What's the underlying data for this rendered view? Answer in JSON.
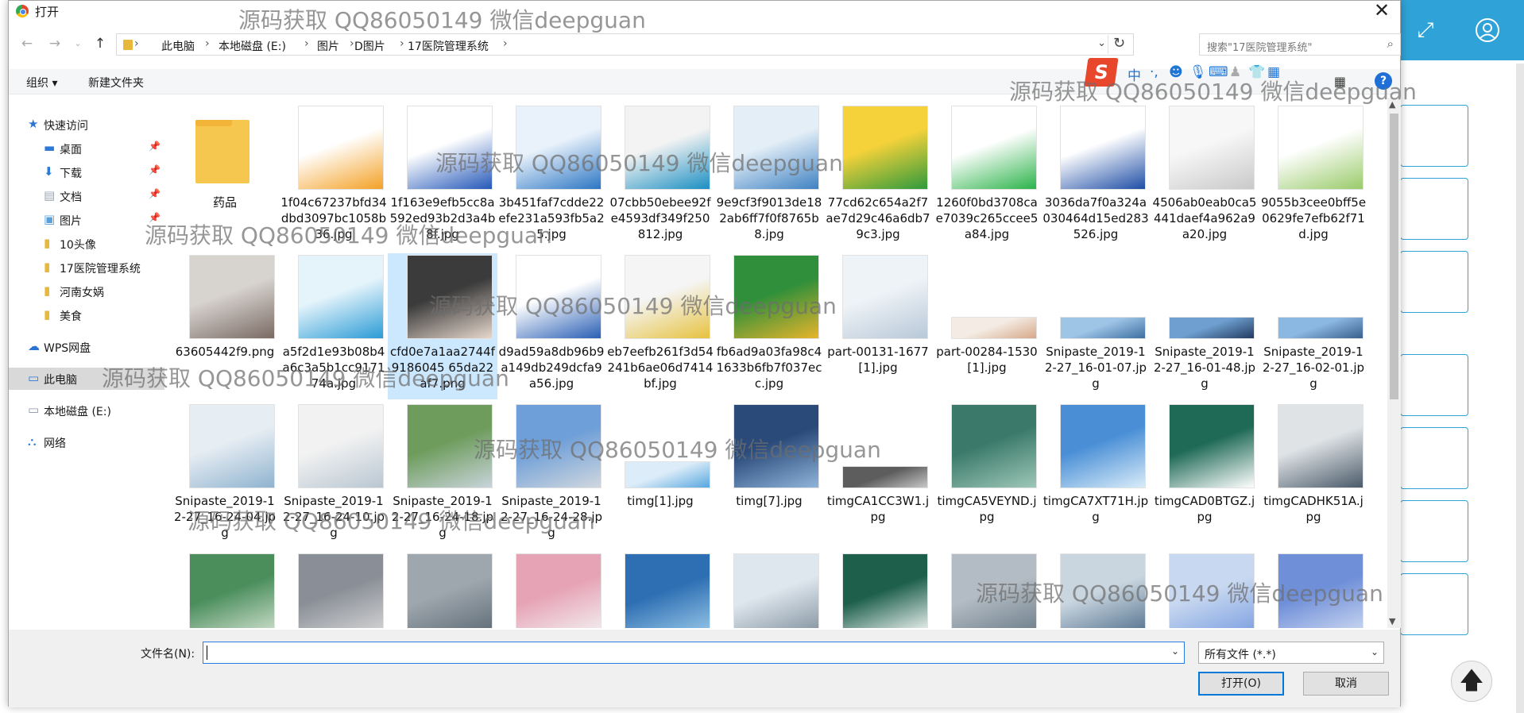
{
  "dialog": {
    "title": "打开"
  },
  "address": {
    "segments": [
      "此电脑",
      "本地磁盘 (E:)",
      "图片",
      "D图片",
      "17医院管理系统"
    ],
    "search_placeholder": "搜索\"17医院管理系统\""
  },
  "toolbar": {
    "organize": "组织 ▾",
    "new_folder": "新建文件夹",
    "help": "?"
  },
  "ime": {
    "logo": "S",
    "lang": "中"
  },
  "sidebar": {
    "items": [
      {
        "label": "快速访问",
        "icon": "star-icon",
        "color": "#2b73d2"
      },
      {
        "label": "桌面",
        "icon": "desktop-icon",
        "color": "#2b7ad8",
        "pinned": true
      },
      {
        "label": "下载",
        "icon": "download-icon",
        "color": "#2b7ad8",
        "pinned": true
      },
      {
        "label": "文档",
        "icon": "document-icon",
        "color": "#9aa6b5",
        "pinned": true
      },
      {
        "label": "图片",
        "icon": "pictures-icon",
        "color": "#5aa0dd",
        "pinned": true
      },
      {
        "label": "10头像",
        "icon": "folder-icon",
        "color": "#e8b83c"
      },
      {
        "label": "17医院管理系统",
        "icon": "folder-icon",
        "color": "#e8b83c"
      },
      {
        "label": "河南女娲",
        "icon": "folder-icon",
        "color": "#e8b83c"
      },
      {
        "label": "美食",
        "icon": "folder-icon",
        "color": "#e8b83c"
      },
      {
        "label": "WPS网盘",
        "icon": "cloud-icon",
        "color": "#2b73d2"
      },
      {
        "label": "此电脑",
        "icon": "computer-icon",
        "color": "#2b7ad8",
        "selected": true
      },
      {
        "label": "本地磁盘 (E:)",
        "icon": "drive-icon",
        "color": "#8a96a3"
      },
      {
        "label": "网络",
        "icon": "network-icon",
        "color": "#2b7ad8"
      }
    ]
  },
  "files": [
    {
      "name": "药品",
      "type": "folder"
    },
    {
      "name": "1f04c67237bfd34dbd3097bc1058b36.jpg",
      "colors": [
        "#ffffff",
        "#f4a126"
      ]
    },
    {
      "name": "1f163e9efb5cc8a592ed93b2d3a4b8f.jpg",
      "colors": [
        "#ffffff",
        "#2558b9"
      ]
    },
    {
      "name": "3b451faf7cdde22efe231a593fb5a25.jpg",
      "colors": [
        "#e9f2fb",
        "#2c76c4"
      ]
    },
    {
      "name": "07cbb50ebee92fe4593df349f250812.jpg",
      "colors": [
        "#f3f3f3",
        "#1b8fc2"
      ]
    },
    {
      "name": "9e9cf3f9013de182ab6ff7f0f8765b8.jpg",
      "colors": [
        "#e3eef7",
        "#3f82c3"
      ]
    },
    {
      "name": "77cd62c654a2f7ae7d29c46a6db79c3.jpg",
      "colors": [
        "#f6d23a",
        "#2f9a3c"
      ]
    },
    {
      "name": "1260f0bd3708cae7039c265ccee5a84.jpg",
      "colors": [
        "#ffffff",
        "#2cb34a"
      ]
    },
    {
      "name": "3036da7f0a324a030464d15ed283526.jpg",
      "colors": [
        "#ffffff",
        "#1f4ea6"
      ]
    },
    {
      "name": "4506ab0eab0ca5441daef4a962a9a20.jpg",
      "colors": [
        "#f7f7f7",
        "#c9c9c9"
      ]
    },
    {
      "name": "9055b3cee0bff5e0629fe7efb62f71d.jpg",
      "colors": [
        "#ffffff",
        "#9acb6a"
      ]
    },
    {
      "name": "63605442f9.png",
      "colors": [
        "#d7d3cf",
        "#7a6a63"
      ]
    },
    {
      "name": "a5f2d1e93b08b4a6c3a5b1cc917174a.jpg",
      "colors": [
        "#e5f4fb",
        "#2b9bd6"
      ]
    },
    {
      "name": "cfd0e7a1aa2744f9186045 65da22af7.png",
      "colors": [
        "#3b3b3b",
        "#e6d7cc"
      ],
      "selected": true
    },
    {
      "name": "d9ad59a8db96b9a149db249dcfa9a56.jpg",
      "colors": [
        "#ffffff",
        "#2a5fb5"
      ]
    },
    {
      "name": "eb7eefb261f3d54241b6ae06d7414bf.jpg",
      "colors": [
        "#f5f5f5",
        "#e6c23f"
      ]
    },
    {
      "name": "fb6ad9a03fa98c41633b6fb7f037ecc.jpg",
      "colors": [
        "#2f8f3a",
        "#e7b42b"
      ]
    },
    {
      "name": "part-00131-1677[1].jpg",
      "colors": [
        "#eef3f7",
        "#b8c8d8"
      ]
    },
    {
      "name": "part-00284-1530[1].jpg",
      "colors": [
        "#f4ece4",
        "#d7a88a"
      ]
    },
    {
      "name": "Snipaste_2019-12-27_16-01-07.jpg",
      "colors": [
        "#9ec4e6",
        "#3d6fa1"
      ]
    },
    {
      "name": "Snipaste_2019-12-27_16-01-48.jpg",
      "colors": [
        "#6e9fd0",
        "#233b60"
      ]
    },
    {
      "name": "Snipaste_2019-12-27_16-02-01.jpg",
      "colors": [
        "#8bb7e3",
        "#3a5f8c"
      ]
    },
    {
      "name": "Snipaste_2019-12-27_16-24-04.jpg",
      "colors": [
        "#e6edf3",
        "#8fb3cf"
      ]
    },
    {
      "name": "Snipaste_2019-12-27_16-24-10.jpg",
      "colors": [
        "#f2f2f2",
        "#b9c7d2"
      ]
    },
    {
      "name": "Snipaste_2019-12-27_16-24-18.jpg",
      "colors": [
        "#6d9c5c",
        "#c9d4db"
      ]
    },
    {
      "name": "Snipaste_2019-12-27_16-24-28.jpg",
      "colors": [
        "#6f9fd8",
        "#d0d7de"
      ]
    },
    {
      "name": "timg[1].jpg",
      "colors": [
        "#dcecf8",
        "#58a7e0"
      ]
    },
    {
      "name": "timg[7].jpg",
      "colors": [
        "#2a4a7a",
        "#8fb4da"
      ]
    },
    {
      "name": "timgCA1CC3W1.jpg",
      "colors": [
        "#5d5d5d",
        "#c7c7c7"
      ]
    },
    {
      "name": "timgCA5VEYND.jpg",
      "colors": [
        "#3b7a6a",
        "#9ec7b8"
      ]
    },
    {
      "name": "timgCA7XT71H.jpg",
      "colors": [
        "#4a8fd6",
        "#d9ecf9"
      ]
    },
    {
      "name": "timgCAD0BTGZ.jpg",
      "colors": [
        "#1f6a56",
        "#ffffff"
      ]
    },
    {
      "name": "timgCADHK51A.jpg",
      "colors": [
        "#dfe3e6",
        "#4b5b6a"
      ]
    },
    {
      "name": "",
      "colors": [
        "#4b8e5c",
        "#d5e3d3"
      ]
    },
    {
      "name": "",
      "colors": [
        "#8a8f97",
        "#d8d8d8"
      ]
    },
    {
      "name": "",
      "colors": [
        "#9fa7ae",
        "#5c6a74"
      ]
    },
    {
      "name": "",
      "colors": [
        "#e6a3b6",
        "#f3f3f3"
      ]
    },
    {
      "name": "",
      "colors": [
        "#2e6fb3",
        "#9ccbea"
      ]
    },
    {
      "name": "",
      "colors": [
        "#dfe7ee",
        "#7f8f9c"
      ]
    },
    {
      "name": "",
      "colors": [
        "#1d5f4b",
        "#ffffff"
      ]
    },
    {
      "name": "",
      "colors": [
        "#b3bcc4",
        "#6b7b88"
      ]
    },
    {
      "name": "",
      "colors": [
        "#c9d6e0",
        "#4e6d8a"
      ]
    },
    {
      "name": "",
      "colors": [
        "#c8d8f0",
        "#7a9ee0"
      ]
    },
    {
      "name": "",
      "colors": [
        "#6f8fd8",
        "#d1dcf3"
      ]
    }
  ],
  "bottom": {
    "filename_label": "文件名(N):",
    "filename_value": "",
    "filetype_value": "所有文件 (*.*)",
    "open_button": "打开(O)",
    "cancel_button": "取消"
  },
  "watermarks": [
    "源码获取 QQ86050149 微信deepguan",
    "源码获取 QQ86050149 微信deepguan",
    "源码获取 QQ86050149 微信deepguan",
    "源码获取 QQ86050149 微信deepguan",
    "源码获取 QQ86050149 微信deepguan",
    "源码获取 QQ86050149 微信deepguan",
    "源码获取 QQ86050149 微信deepguan",
    "源码获取 QQ86050149 微信deepguan",
    "源码获取 QQ86050149 微信deepguan"
  ]
}
